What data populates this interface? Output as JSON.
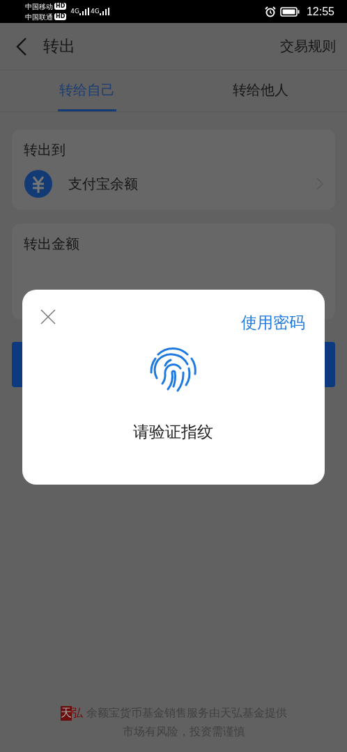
{
  "status_bar": {
    "carriers": [
      {
        "name": "中国移动",
        "badge": "HD",
        "network": "4G"
      },
      {
        "name": "中国联通",
        "badge": "HD",
        "network": "4G"
      }
    ],
    "time": "12:55"
  },
  "header": {
    "title": "转出",
    "action": "交易规则"
  },
  "tabs": [
    {
      "label": "转给自己",
      "selected": true
    },
    {
      "label": "转给他人",
      "selected": false
    }
  ],
  "destination": {
    "label": "转出到",
    "account": "支付宝余额"
  },
  "amount": {
    "label": "转出金额"
  },
  "dialog": {
    "action": "使用密码",
    "prompt": "请验证指纹"
  },
  "footer": {
    "logo": [
      "天",
      "弘"
    ],
    "lines": [
      "余额宝货币基金销售服务由天弘基金提供",
      "市场有风险，投资需谨慎"
    ]
  }
}
